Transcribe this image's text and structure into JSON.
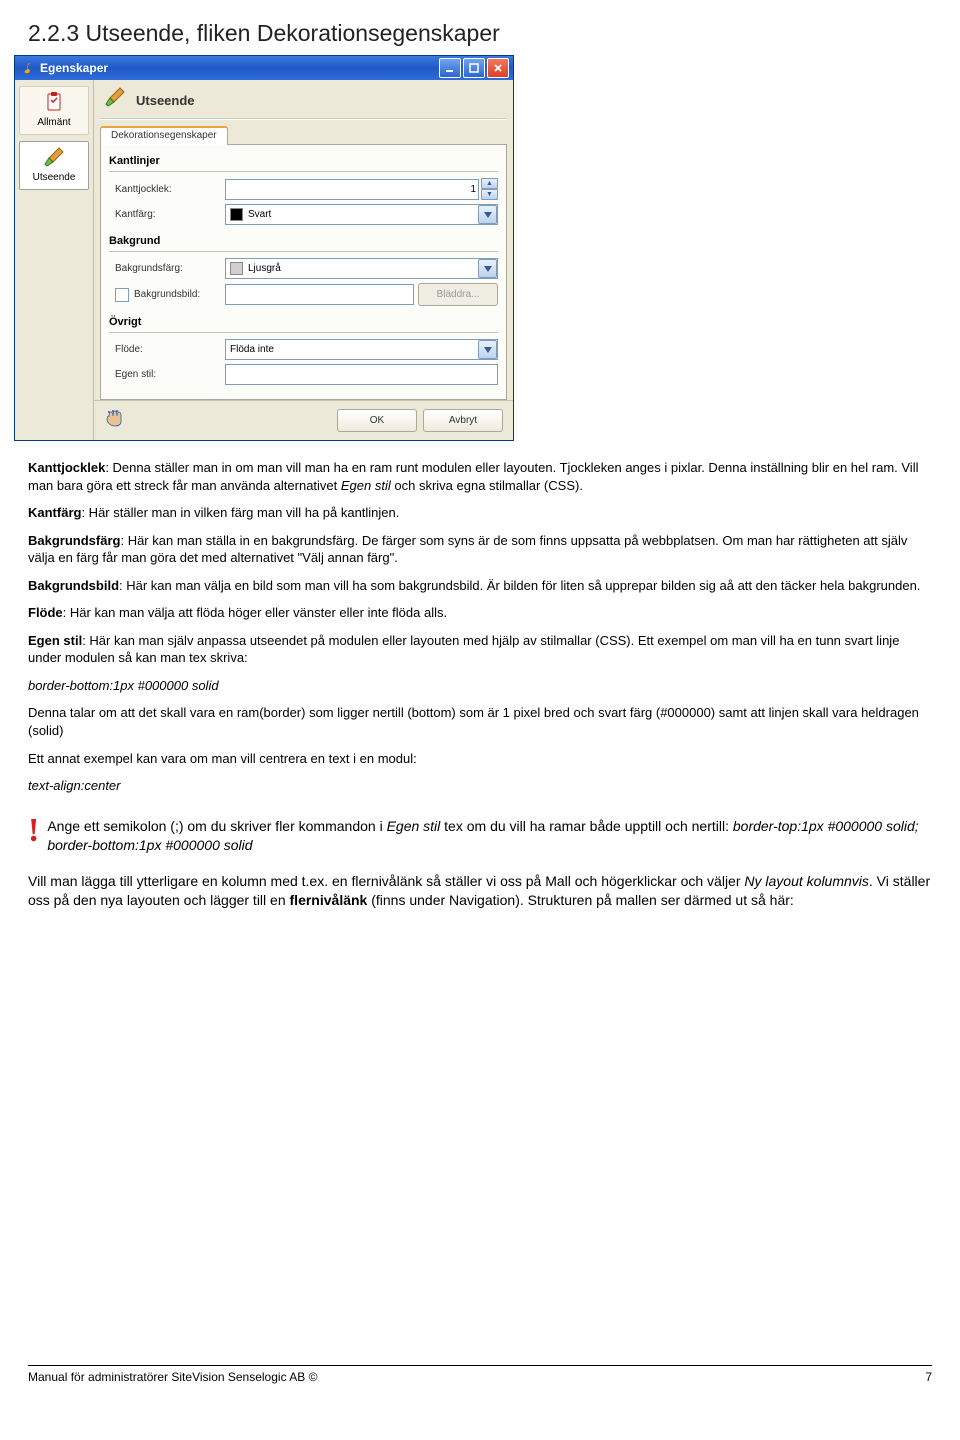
{
  "heading": "2.2.3 Utseende, fliken Dekorationsegenskaper",
  "dialog": {
    "title": "Egenskaper",
    "sidebar": {
      "allmant": "Allmänt",
      "utseende": "Utseende"
    },
    "panel_title": "Utseende",
    "tab": "Dekorationsegenskaper",
    "fs_kantlinjer": "Kantlinjer",
    "lbl_kanttjocklek": "Kanttjocklek:",
    "val_kanttjocklek": "1",
    "lbl_kantfarg": "Kantfärg:",
    "val_kantfarg": "Svart",
    "fs_bakgrund": "Bakgrund",
    "lbl_bakgrundsfarg": "Bakgrundsfärg:",
    "val_bakgrundsfarg": "Ljusgrå",
    "chk_bakgrundsbild": "Bakgrundsbild:",
    "val_bakgrundsbild": "",
    "btn_bladdra": "Bläddra...",
    "fs_ovrigt": "Övrigt",
    "lbl_flode": "Flöde:",
    "val_flode": "Flöda inte",
    "lbl_egenstil": "Egen stil:",
    "val_egenstil": "",
    "btn_ok": "OK",
    "btn_cancel": "Avbryt"
  },
  "body": {
    "p1_b": "Kanttjocklek",
    "p1_r": ": Denna ställer man in om man vill man ha en ram runt modulen eller layouten. Tjockleken anges i pixlar. Denna inställning blir en hel ram. Vill man bara göra ett streck får man använda alternativet ",
    "p1_i": "Egen stil",
    "p1_t": " och skriva egna stilmallar (CSS).",
    "p2_b": "Kantfärg",
    "p2_r": ": Här ställer man in vilken färg man vill ha på kantlinjen.",
    "p3_b": "Bakgrundsfärg",
    "p3_r": ": Här kan man ställa in en bakgrundsfärg. De färger som syns är de som finns uppsatta på webbplatsen. Om man har rättigheten att själv välja en färg får man göra det med alternativet \"Välj annan färg\".",
    "p4_b": "Bakgrundsbild",
    "p4_r": ": Här kan man välja en bild som man vill ha som bakgrundsbild. Är bilden för liten så upprepar bilden sig aå att den täcker hela bakgrunden.",
    "p5_b": "Flöde",
    "p5_r": ": Här kan man välja att flöda höger eller vänster eller inte flöda alls.",
    "p6_b": "Egen stil",
    "p6_r": ": Här kan man själv anpassa utseendet på modulen eller layouten med hjälp av stilmallar (CSS). Ett exempel om man vill ha en tunn svart linje under modulen så kan man tex skriva:",
    "code1": "border-bottom:1px #000000 solid",
    "p7": "Denna talar om att det skall vara en ram(border) som ligger nertill (bottom) som är 1 pixel bred och svart färg (#000000) samt att linjen skall vara heldragen (solid)",
    "p8": "Ett annat exempel kan vara om man vill centrera en text i en modul:",
    "code2": "text-align:center",
    "alert_a": "Ange ett semikolon (;) om du skriver fler kommandon i ",
    "alert_i1": "Egen stil",
    "alert_b": " tex om du vill ha ramar både upptill och nertill: ",
    "alert_i2": "border-top:1px #000000 solid; border-bottom:1px #000000 solid",
    "p9_a": "Vill man lägga till ytterligare en kolumn med t.ex. en  flernivålänk så ställer vi oss på Mall och högerklickar och väljer ",
    "p9_i": "Ny layout kolumnvis",
    "p9_b": ". Vi ställer oss på den nya layouten och lägger till en ",
    "p9_bold": "flernivålänk",
    "p9_c": " (finns under Navigation). Strukturen på mallen ser därmed ut så här:"
  },
  "footer": {
    "left": "Manual för administratörer SiteVision Senselogic AB ©",
    "right": "7"
  }
}
